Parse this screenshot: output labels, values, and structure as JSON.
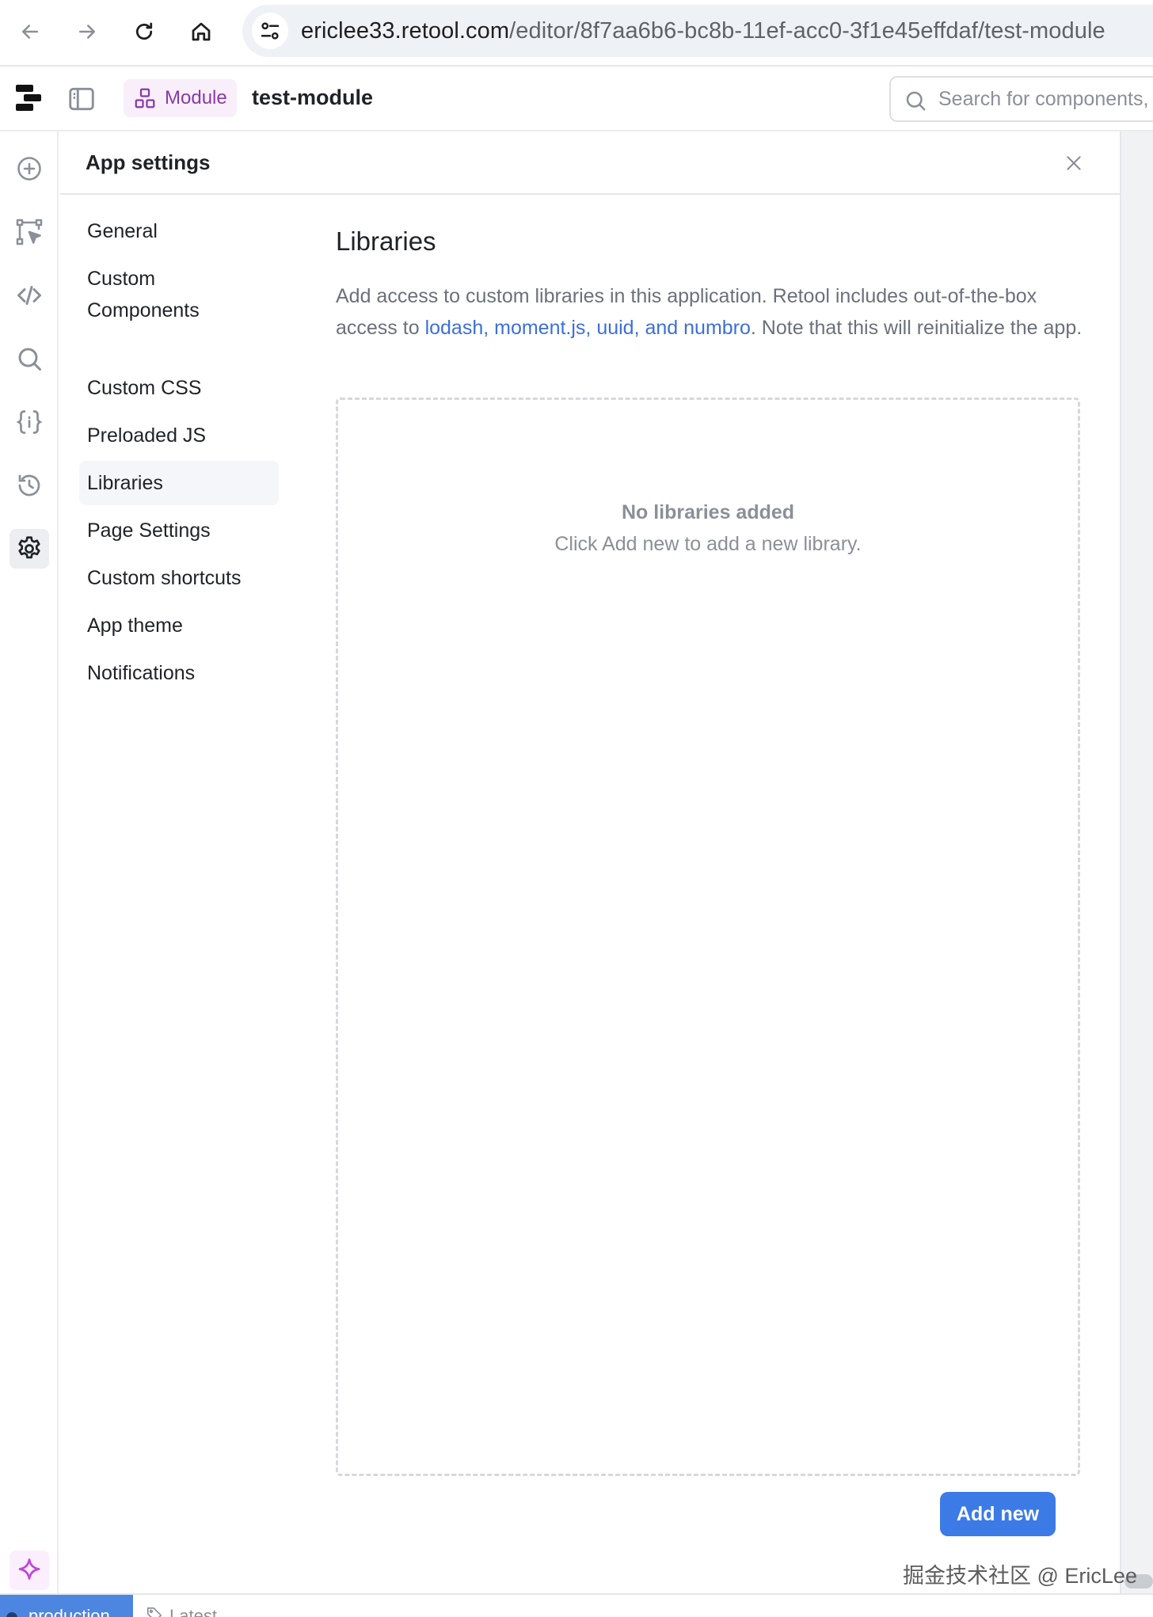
{
  "browser": {
    "url_host": "ericlee33.retool.com",
    "url_path": "/editor/8f7aa6b6-bc8b-11ef-acc0-3f1e45effdaf/test-module"
  },
  "header": {
    "module_label": "Module",
    "app_name": "test-module",
    "search_placeholder": "Search for components, queries"
  },
  "settings": {
    "title": "App settings",
    "nav": [
      {
        "label": "General"
      },
      {
        "label": "Custom Components"
      },
      {
        "label": "Custom CSS"
      },
      {
        "label": "Preloaded JS"
      },
      {
        "label": "Libraries"
      },
      {
        "label": "Page Settings"
      },
      {
        "label": "Custom shortcuts"
      },
      {
        "label": "App theme"
      },
      {
        "label": "Notifications"
      }
    ],
    "active_nav": "Libraries"
  },
  "libraries": {
    "title": "Libraries",
    "desc_before": "Add access to custom libraries in this application. Retool includes out-of-the-box access to ",
    "desc_link": "lodash, moment.js, uuid, and numbro",
    "desc_after": ". Note that this will reinitialize the app.",
    "empty_title": "No libraries added",
    "empty_subtitle": "Click Add new to add a new library.",
    "add_button": "Add new"
  },
  "status_bar": {
    "environment": "production",
    "version": "Latest"
  },
  "watermark": "掘金技术社区 @ EricLee",
  "colors": {
    "accent": "#3c7ae6",
    "link": "#3d6fd9",
    "module_purple": "#8a3aa8",
    "environment": "#4d86e0"
  }
}
